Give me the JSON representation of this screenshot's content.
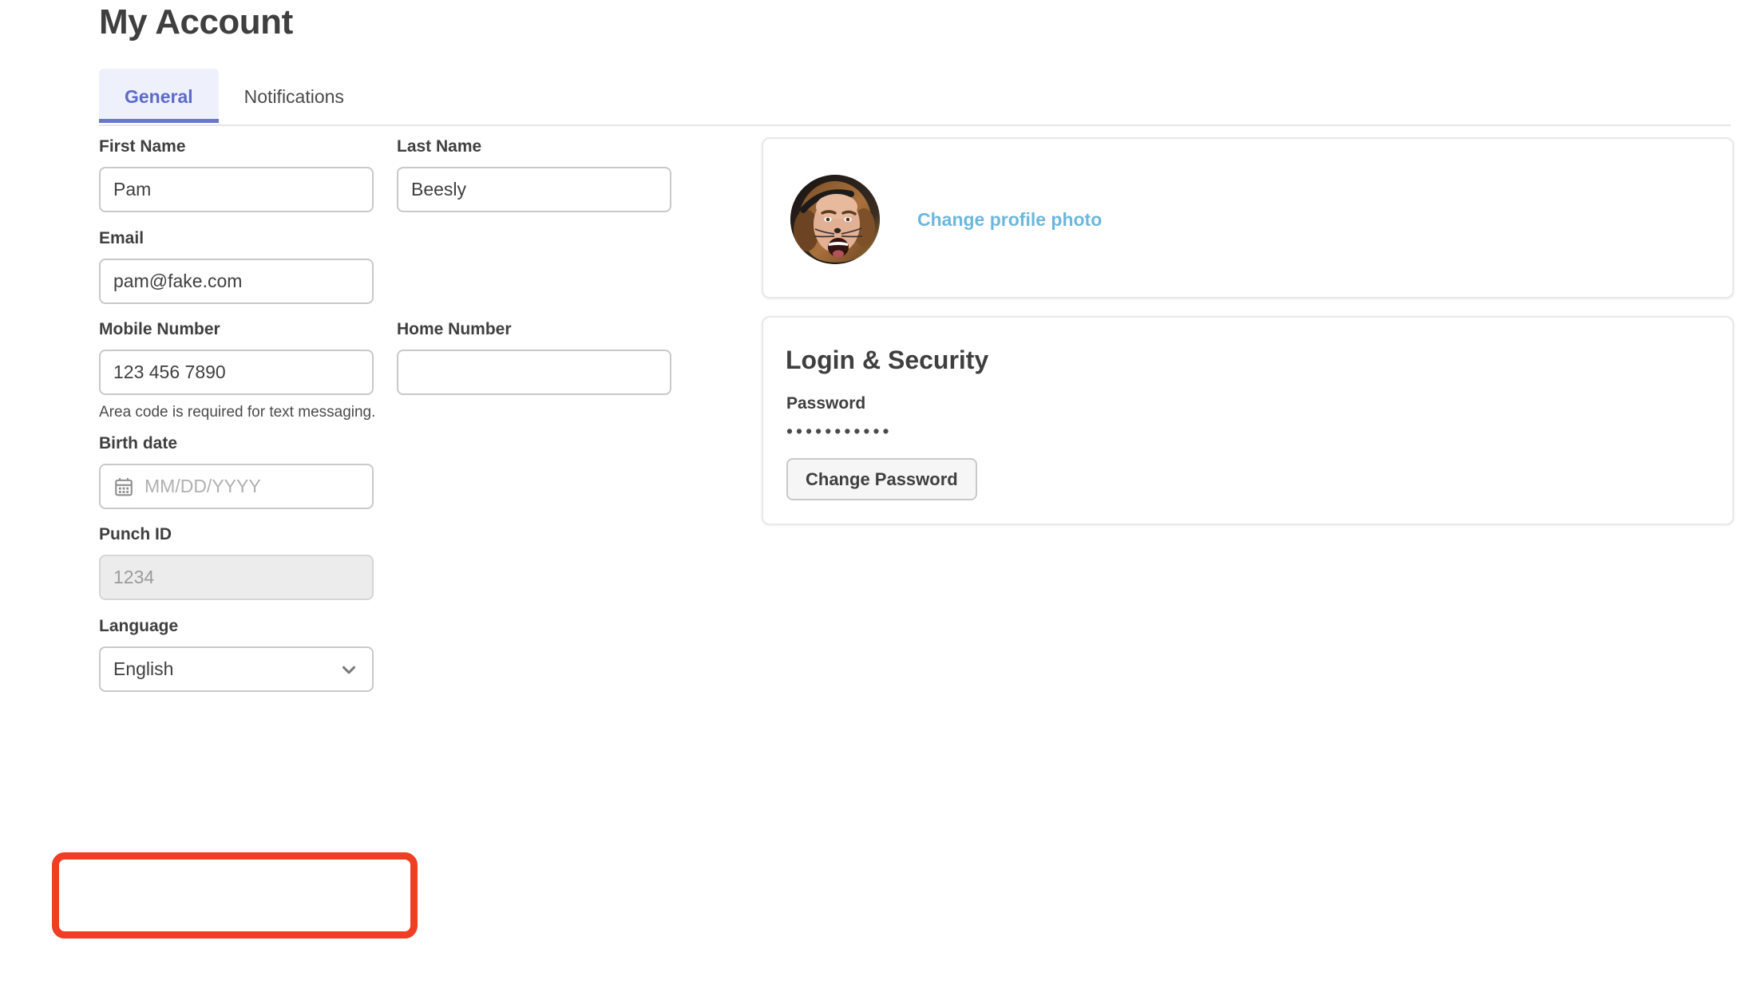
{
  "page": {
    "title": "My Account"
  },
  "tabs": [
    {
      "label": "General",
      "active": true
    },
    {
      "label": "Notifications",
      "active": false
    }
  ],
  "form": {
    "first_name": {
      "label": "First Name",
      "value": "Pam"
    },
    "last_name": {
      "label": "Last Name",
      "value": "Beesly"
    },
    "email": {
      "label": "Email",
      "value": "pam@fake.com"
    },
    "mobile_number": {
      "label": "Mobile Number",
      "value": "123 456 7890",
      "helper": "Area code is required for text messaging."
    },
    "home_number": {
      "label": "Home Number",
      "value": ""
    },
    "birth_date": {
      "label": "Birth date",
      "value": "",
      "placeholder": "MM/DD/YYYY",
      "icon": "calendar-icon"
    },
    "punch_id": {
      "label": "Punch ID",
      "value": "1234",
      "disabled": true
    },
    "language": {
      "label": "Language",
      "value": "English",
      "icon": "chevron-down-icon",
      "highlighted": true
    }
  },
  "photo_card": {
    "avatar_alt": "profile-photo",
    "change_label": "Change profile photo"
  },
  "security_card": {
    "title": "Login & Security",
    "password_label": "Password",
    "password_mask": "•••••••••••",
    "change_password_label": "Change Password"
  },
  "colors": {
    "accent_tab": "#6877c8",
    "tab_active_bg": "#eef0fb",
    "link_blue": "#6cb7dd",
    "annotation_red": "#ef3e23",
    "border_gray": "#c9c9c9",
    "disabled_bg": "#ececec"
  }
}
